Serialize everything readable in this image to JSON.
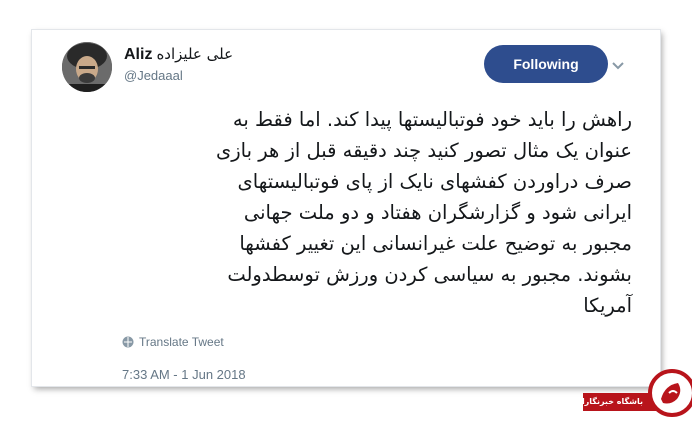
{
  "user": {
    "name_latin": "Aliz",
    "name_farsi": "علی علیزاده",
    "handle": "@Jedaaal"
  },
  "follow_button": {
    "label": "Following"
  },
  "tweet": {
    "lines": [
      "راهش را باید خود فوتبالیستها پیدا کند. اما فقط به",
      "عنوان یک مثال تصور کنید چند دقیقه قبل از هر بازی",
      "صرف دراوردن کفشهای نایک از پای فوتبالیستهای",
      "ایرانی شود و گزارشگران هفتاد و دو ملت جهانی",
      "مجبور به توضیح علت غیرانسانی این تغییر کفشها",
      "بشوند. مجبور به سیاسی کردن ورزش توسطدولت",
      "آمریکا"
    ],
    "translate_label": "Translate Tweet",
    "timestamp": "7:33 AM - 1 Jun 2018"
  },
  "watermark": {
    "text": "باشگاه خبرنگاران"
  },
  "colors": {
    "follow_bg": "#2e4d8e",
    "watermark_red": "#b8141b"
  },
  "icons": [
    "chevron-down-icon",
    "globe-icon"
  ]
}
